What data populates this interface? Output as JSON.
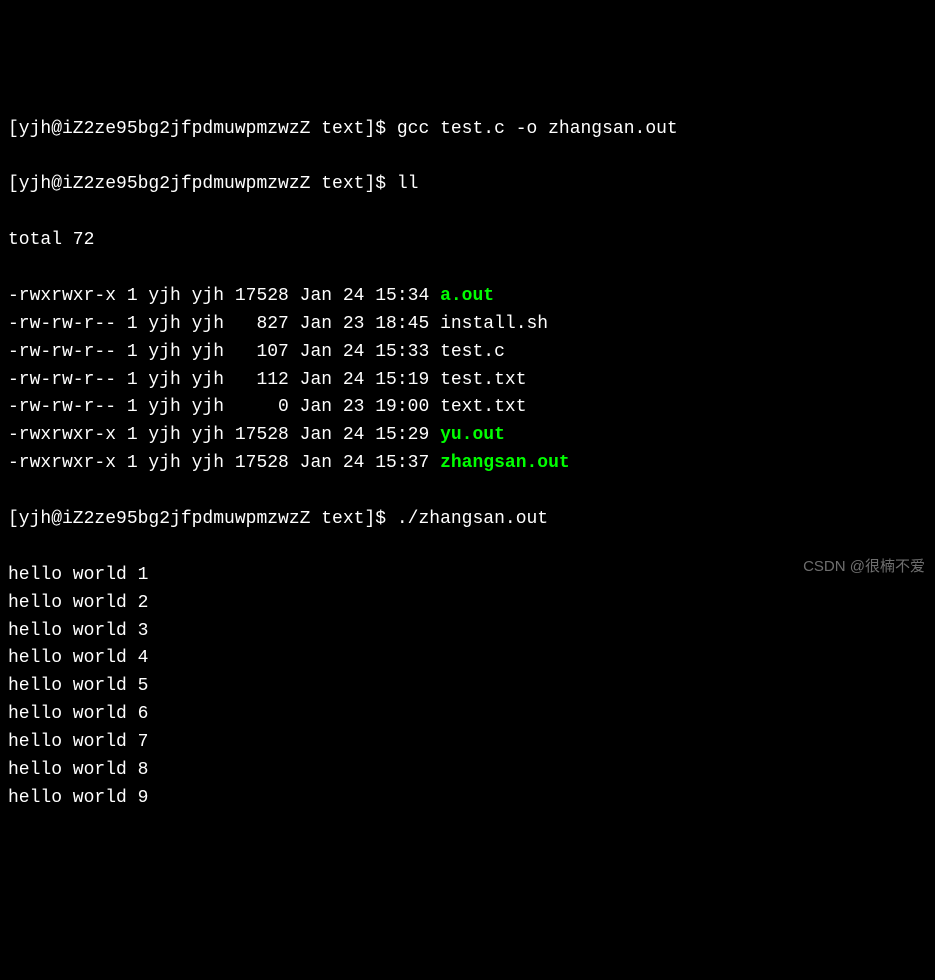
{
  "prompts": [
    {
      "prefix": "[yjh@iZ2ze95bg2jfpdmuwpmzwzZ text]$ ",
      "cmd": "gcc test.c -o zhangsan.out"
    },
    {
      "prefix": "[yjh@iZ2ze95bg2jfpdmuwpmzwzZ text]$ ",
      "cmd": "ll"
    }
  ],
  "total_line": "total 72",
  "files": [
    {
      "perms": "-rwxrwxr-x",
      "links": "1",
      "owner": "yjh",
      "group": "yjh",
      "size": "17528",
      "date": "Jan 24 15:34",
      "name": "a.out",
      "exec": true
    },
    {
      "perms": "-rw-rw-r--",
      "links": "1",
      "owner": "yjh",
      "group": "yjh",
      "size": "  827",
      "date": "Jan 23 18:45",
      "name": "install.sh",
      "exec": false
    },
    {
      "perms": "-rw-rw-r--",
      "links": "1",
      "owner": "yjh",
      "group": "yjh",
      "size": "  107",
      "date": "Jan 24 15:33",
      "name": "test.c",
      "exec": false
    },
    {
      "perms": "-rw-rw-r--",
      "links": "1",
      "owner": "yjh",
      "group": "yjh",
      "size": "  112",
      "date": "Jan 24 15:19",
      "name": "test.txt",
      "exec": false
    },
    {
      "perms": "-rw-rw-r--",
      "links": "1",
      "owner": "yjh",
      "group": "yjh",
      "size": "    0",
      "date": "Jan 23 19:00",
      "name": "text.txt",
      "exec": false
    },
    {
      "perms": "-rwxrwxr-x",
      "links": "1",
      "owner": "yjh",
      "group": "yjh",
      "size": "17528",
      "date": "Jan 24 15:29",
      "name": "yu.out",
      "exec": true
    },
    {
      "perms": "-rwxrwxr-x",
      "links": "1",
      "owner": "yjh",
      "group": "yjh",
      "size": "17528",
      "date": "Jan 24 15:37",
      "name": "zhangsan.out",
      "exec": true
    }
  ],
  "prompt3": {
    "prefix": "[yjh@iZ2ze95bg2jfpdmuwpmzwzZ text]$ ",
    "cmd": "./zhangsan.out"
  },
  "output": [
    "hello world 1",
    "hello world 2",
    "hello world 3",
    "hello world 4",
    "hello world 5",
    "hello world 6",
    "hello world 7",
    "hello world 8",
    "hello world 9"
  ],
  "watermark": "CSDN @很楠不爱"
}
